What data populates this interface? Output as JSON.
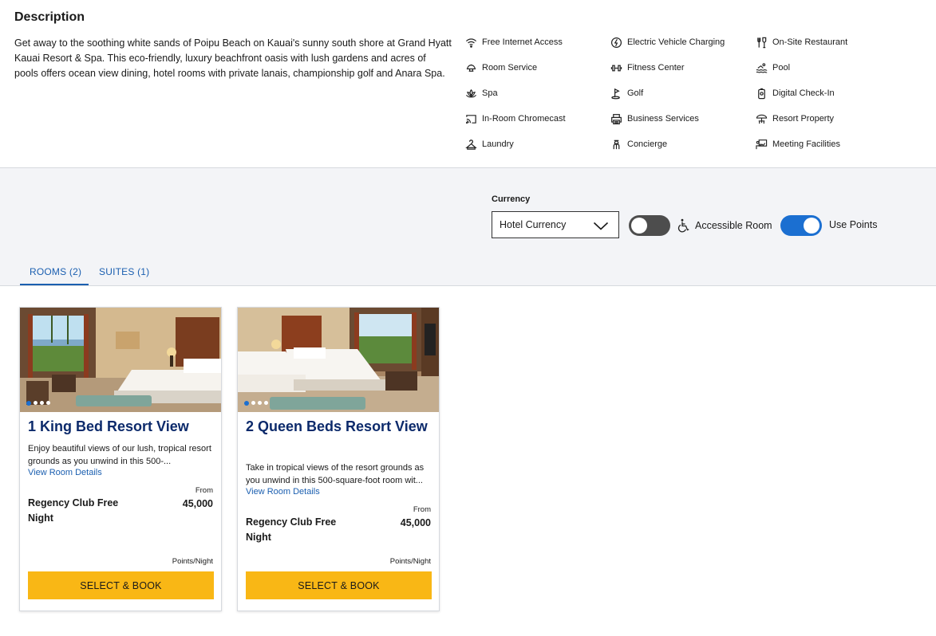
{
  "description": {
    "title": "Description",
    "text": "Get away to the soothing white sands of Poipu Beach on Kauai's sunny south shore at Grand Hyatt Kauai Resort & Spa. This eco-friendly, luxury beachfront oasis with lush gardens and acres of pools offers ocean view dining, hotel rooms with private lanais, championship golf and Anara Spa."
  },
  "amenities": [
    {
      "label": "Free Internet Access",
      "icon": "wifi-icon"
    },
    {
      "label": "Electric Vehicle Charging",
      "icon": "ev-charging-icon"
    },
    {
      "label": "On-Site Restaurant",
      "icon": "restaurant-icon"
    },
    {
      "label": "Room Service",
      "icon": "room-service-icon"
    },
    {
      "label": "Fitness Center",
      "icon": "dumbbell-icon"
    },
    {
      "label": "Pool",
      "icon": "pool-icon"
    },
    {
      "label": "Spa",
      "icon": "lotus-icon"
    },
    {
      "label": "Golf",
      "icon": "golf-icon"
    },
    {
      "label": "Digital Check-In",
      "icon": "phone-icon"
    },
    {
      "label": "In-Room Chromecast",
      "icon": "cast-icon"
    },
    {
      "label": "Business Services",
      "icon": "printer-icon"
    },
    {
      "label": "Resort Property",
      "icon": "beach-umbrella-icon"
    },
    {
      "label": "Laundry",
      "icon": "laundry-icon"
    },
    {
      "label": "Concierge",
      "icon": "concierge-icon"
    },
    {
      "label": "Meeting Facilities",
      "icon": "presentation-icon"
    }
  ],
  "filters": {
    "currency_label": "Currency",
    "currency_value": "Hotel Currency",
    "accessible_label": "Accessible Room",
    "accessible_on": false,
    "use_points_label": "Use Points",
    "use_points_on": true
  },
  "tabs": [
    {
      "label": "ROOMS (2)",
      "active": true
    },
    {
      "label": "SUITES (1)",
      "active": false
    }
  ],
  "rooms": [
    {
      "name": "1 King Bed Resort View",
      "blurb": "Enjoy beautiful views of our lush, tropical resort grounds as you unwind in this 500-...",
      "details_link": "View Room Details",
      "from_label": "From",
      "rate_name": "Regency Club Free Night",
      "points": "45,000",
      "per_night_label": "Points/Night",
      "book_label": "SELECT & BOOK",
      "photo_count": 4,
      "photo_index": 1
    },
    {
      "name": "2 Queen Beds Resort View",
      "blurb": "Take in tropical views of the resort grounds as you unwind in this 500-square-foot room wit...",
      "details_link": "View Room Details",
      "from_label": "From",
      "rate_name": "Regency Club Free Night",
      "points": "45,000",
      "per_night_label": "Points/Night",
      "book_label": "SELECT & BOOK",
      "photo_count": 4,
      "photo_index": 1
    }
  ],
  "colors": {
    "accent_blue": "#1b6fd1",
    "room_title_navy": "#0c2a6b",
    "book_button_yellow": "#f9b715",
    "filter_band_bg": "#f3f4f7"
  }
}
